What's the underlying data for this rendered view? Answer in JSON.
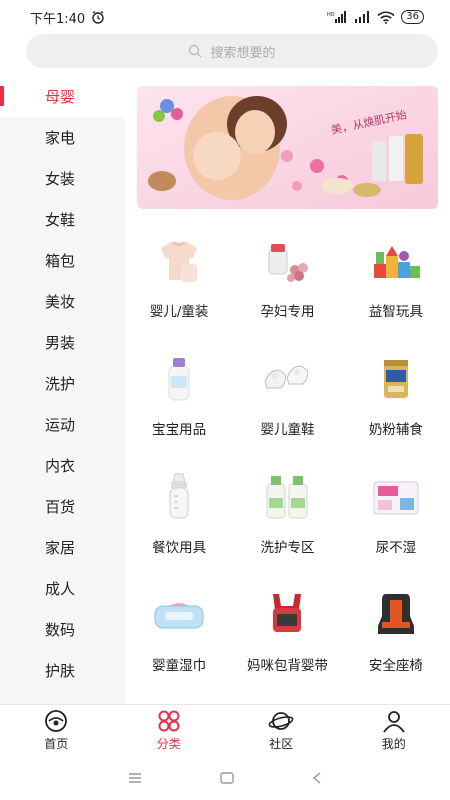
{
  "status_bar": {
    "time": "下午1:40",
    "network_label": "HD",
    "battery": "36"
  },
  "search": {
    "placeholder": "搜索想要的"
  },
  "sidebar": {
    "items": [
      {
        "label": "母婴",
        "active": true
      },
      {
        "label": "家电"
      },
      {
        "label": "女装"
      },
      {
        "label": "女鞋"
      },
      {
        "label": "箱包"
      },
      {
        "label": "美妆"
      },
      {
        "label": "男装"
      },
      {
        "label": "洗护"
      },
      {
        "label": "运动"
      },
      {
        "label": "内衣"
      },
      {
        "label": "百货"
      },
      {
        "label": "家居"
      },
      {
        "label": "成人"
      },
      {
        "label": "数码"
      },
      {
        "label": "护肤"
      }
    ]
  },
  "banner": {
    "slogan": "美，从焕肌开始"
  },
  "categories": [
    {
      "label": "婴儿/童装",
      "icon": "baby-clothes-icon"
    },
    {
      "label": "孕妇专用",
      "icon": "maternity-icon"
    },
    {
      "label": "益智玩具",
      "icon": "toy-blocks-icon"
    },
    {
      "label": "宝宝用品",
      "icon": "baby-lotion-icon"
    },
    {
      "label": "婴儿童鞋",
      "icon": "baby-shoes-icon"
    },
    {
      "label": "奶粉辅食",
      "icon": "milk-powder-icon"
    },
    {
      "label": "餐饮用具",
      "icon": "feeding-bottle-icon"
    },
    {
      "label": "洗护专区",
      "icon": "detergent-icon"
    },
    {
      "label": "尿不湿",
      "icon": "diaper-icon"
    },
    {
      "label": "婴童湿巾",
      "icon": "wet-wipes-icon"
    },
    {
      "label": "妈咪包背婴带",
      "icon": "baby-carrier-icon"
    },
    {
      "label": "安全座椅",
      "icon": "car-seat-icon"
    }
  ],
  "bottom_nav": [
    {
      "label": "首页",
      "icon": "home-icon"
    },
    {
      "label": "分类",
      "icon": "category-icon",
      "active": true
    },
    {
      "label": "社区",
      "icon": "community-icon"
    },
    {
      "label": "我的",
      "icon": "profile-icon"
    }
  ],
  "colors": {
    "accent": "#e8304a",
    "sidebar_bg": "#f6f6f6",
    "search_bg": "#efefef"
  }
}
